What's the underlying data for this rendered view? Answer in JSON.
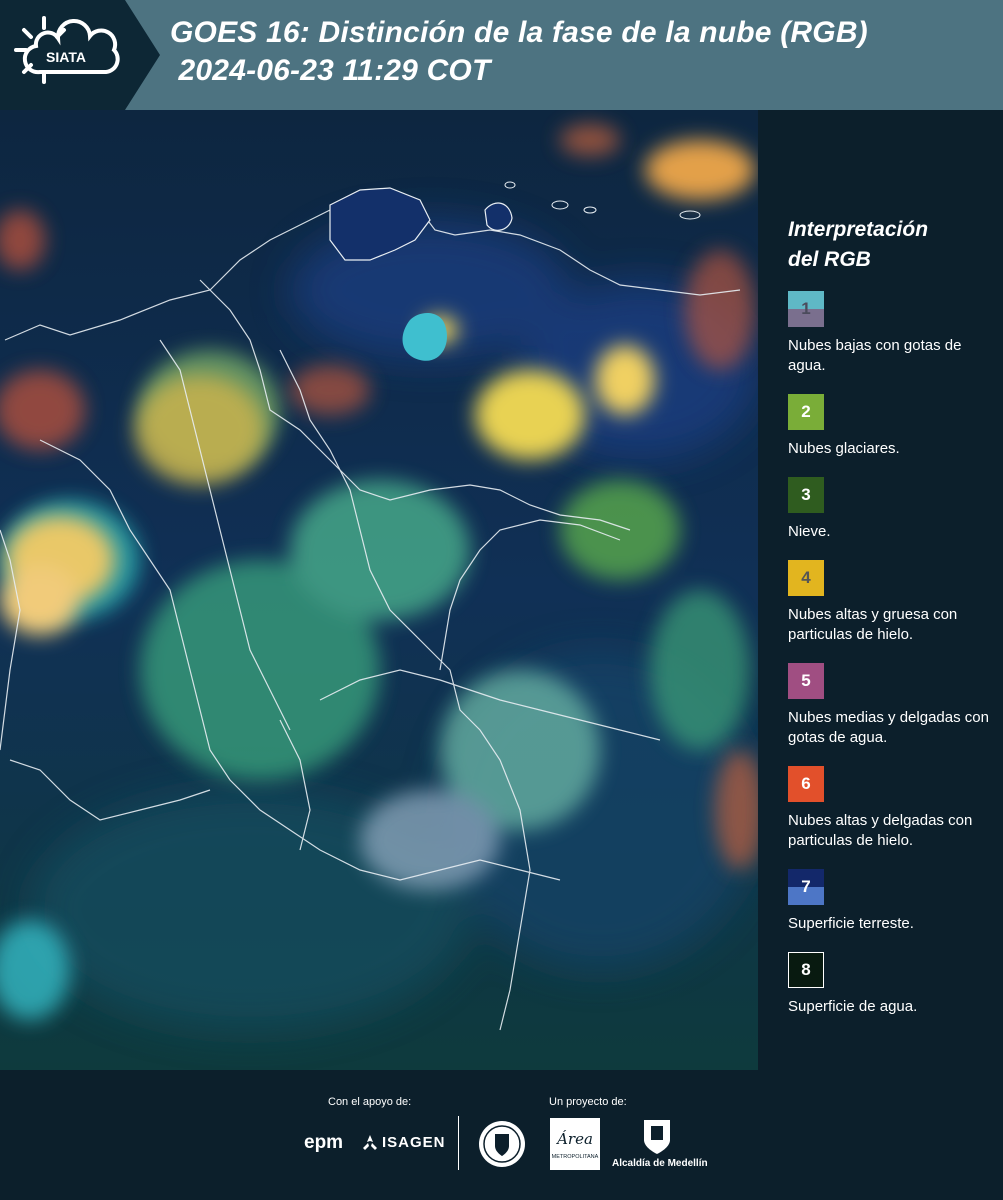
{
  "header": {
    "logo_text": "SIATA",
    "title": "GOES 16: Distinción de la fase de la nube (RGB)\n 2024-06-23 11:29 COT"
  },
  "legend": {
    "title": "Interpretación\ndel RGB",
    "items": [
      {
        "number": "1",
        "colors": [
          "#5fb8c6",
          "#7a6f8e"
        ],
        "number_color": "#4b4b5c",
        "label": "Nubes bajas con gotas de agua."
      },
      {
        "number": "2",
        "colors": [
          "#7aad38"
        ],
        "number_color": "#ffffff",
        "label": "Nubes glaciares."
      },
      {
        "number": "3",
        "colors": [
          "#2f5c1f"
        ],
        "number_color": "#ffffff",
        "label": "Nieve."
      },
      {
        "number": "4",
        "colors": [
          "#e2b51f"
        ],
        "number_color": "#555555",
        "label": "Nubes altas y gruesa con particulas de hielo."
      },
      {
        "number": "5",
        "colors": [
          "#a04e82"
        ],
        "number_color": "#ffffff",
        "label": "Nubes medias y delgadas con gotas de agua."
      },
      {
        "number": "6",
        "colors": [
          "#e2502b"
        ],
        "number_color": "#ffffff",
        "label": "Nubes altas y delgadas con particulas de hielo."
      },
      {
        "number": "7",
        "colors": [
          "#13286a",
          "#4d76c6"
        ],
        "number_color": "#ffffff",
        "label": "Superficie terreste."
      },
      {
        "number": "8",
        "colors": [
          "#081a10"
        ],
        "number_color": "#ffffff",
        "label": "Superficie de agua."
      }
    ]
  },
  "footer": {
    "support_label": "Con el apoyo de:",
    "project_label": "Un proyecto de:",
    "epm": "epm",
    "isagen": "ISAGEN",
    "area_text": "Área",
    "area_sub": "METROPOLITANA",
    "alcaldia": "Alcaldía de Medellín"
  }
}
